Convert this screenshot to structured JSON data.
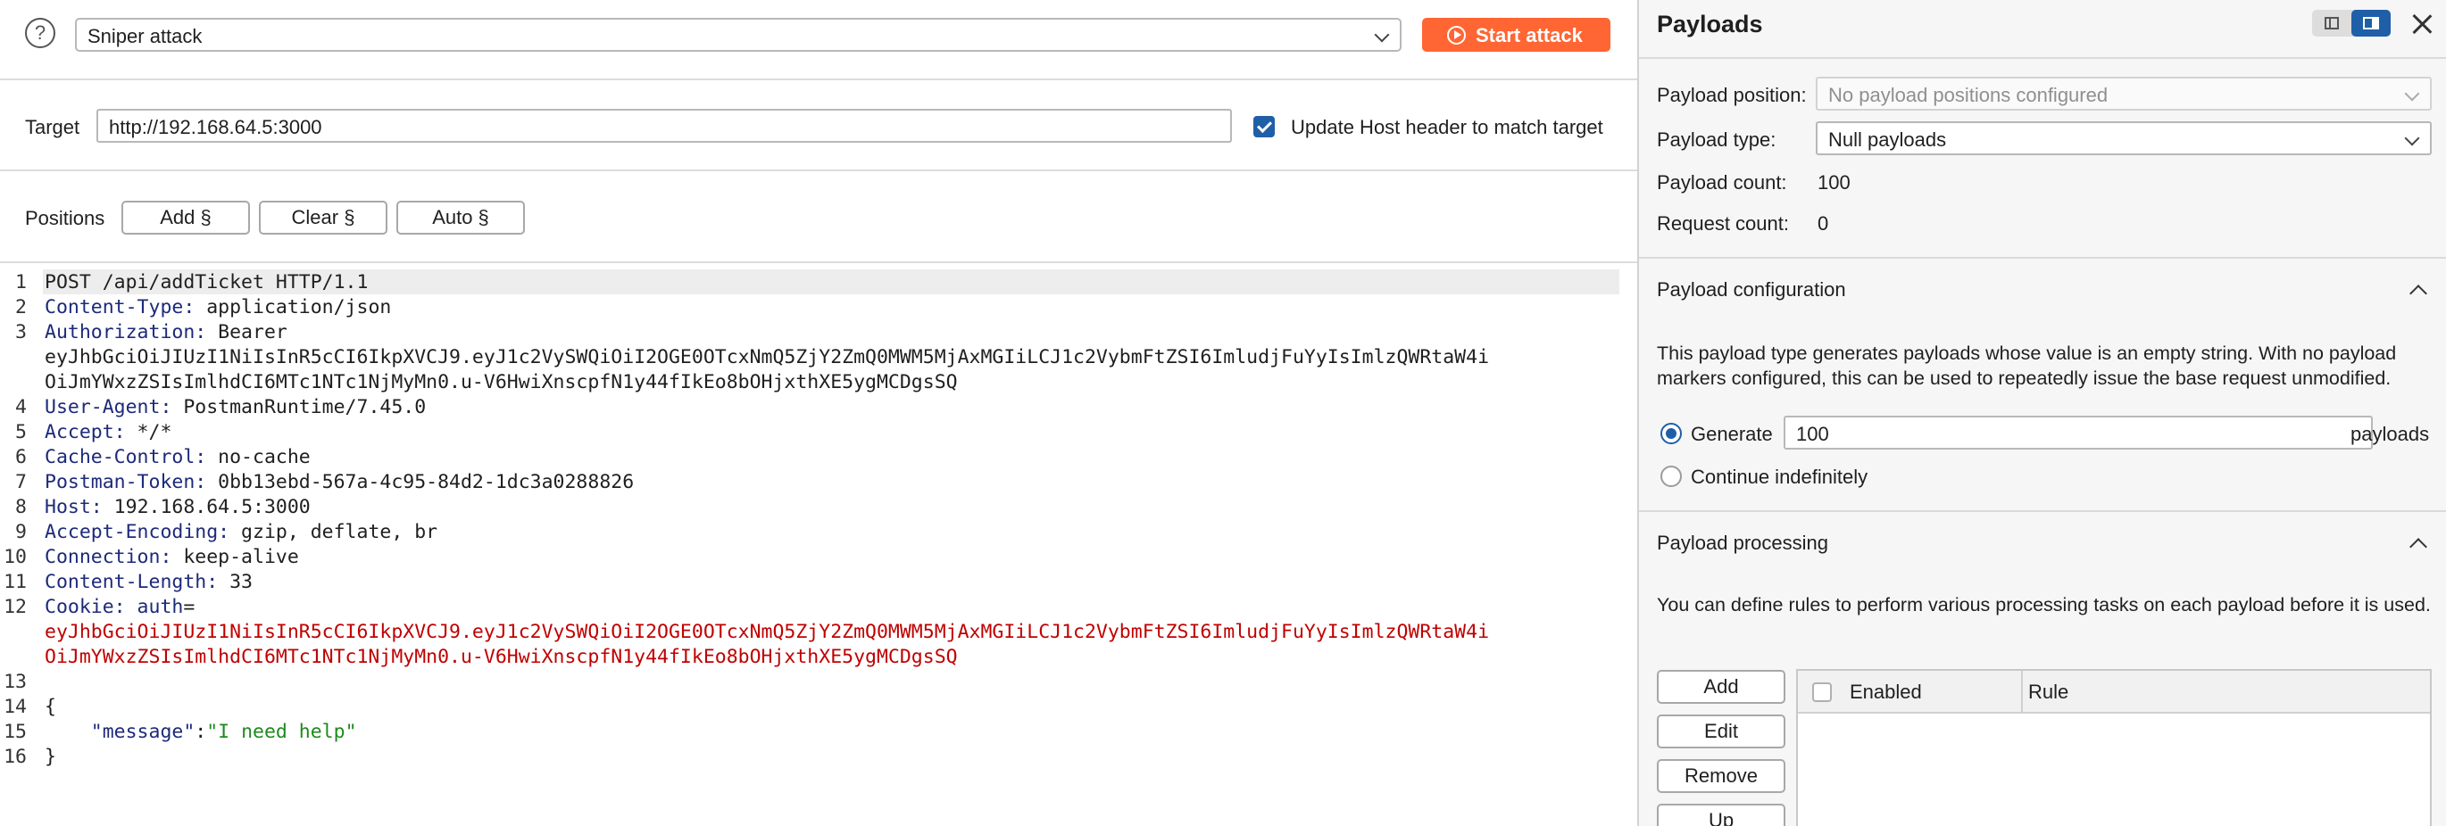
{
  "attack_bar": {
    "attack_type": "Sniper attack",
    "start_attack_label": "Start attack"
  },
  "target": {
    "label": "Target",
    "value": "http://192.168.64.5:3000",
    "update_host_label": "Update Host header to match target",
    "update_host_checked": true
  },
  "positions": {
    "label": "Positions",
    "add_label": "Add §",
    "clear_label": "Clear §",
    "auto_label": "Auto §"
  },
  "request": {
    "line_numbers": [
      "1",
      "2",
      "3",
      "4",
      "5",
      "6",
      "7",
      "8",
      "9",
      "10",
      "11",
      "12",
      "13",
      "14",
      "15",
      "16"
    ],
    "l1": "POST /api/addTicket HTTP/1.1",
    "l2_name": "Content-Type:",
    "l2_val": " application/json",
    "l3_name": "Authorization:",
    "l3_val": " Bearer",
    "l3_wrap1": "eyJhbGciOiJIUzI1NiIsInR5cCI6IkpXVCJ9.eyJ1c2VySWQiOiI2OGE0OTcxNmQ5ZjY2ZmQ0MWM5MjAxMGIiLCJ1c2VybmFtZSI6ImludjFuYyIsImlzQWRtaW4i",
    "l3_wrap2": "OiJmYWxzZSIsImlhdCI6MTc1NTc1NjMyMn0.u-V6HwiXnscpfN1y44fIkEo8bOHjxthXE5ygMCDgsSQ",
    "l4_name": "User-Agent:",
    "l4_val": " PostmanRuntime/7.45.0",
    "l5_name": "Accept:",
    "l5_val": " */*",
    "l6_name": "Cache-Control:",
    "l6_val": " no-cache",
    "l7_name": "Postman-Token:",
    "l7_val": " 0bb13ebd-567a-4c95-84d2-1dc3a0288826",
    "l8_name": "Host:",
    "l8_val": " 192.168.64.5:3000",
    "l9_name": "Accept-Encoding:",
    "l9_val": " gzip, deflate, br",
    "l10_name": "Connection:",
    "l10_val": " keep-alive",
    "l11_name": "Content-Length:",
    "l11_val": " 33",
    "l12_name": "Cookie:",
    "l12_key": " auth",
    "l12_eq": "=",
    "l12_wrap1": "eyJhbGciOiJIUzI1NiIsInR5cCI6IkpXVCJ9.eyJ1c2VySWQiOiI2OGE0OTcxNmQ5ZjY2ZmQ0MWM5MjAxMGIiLCJ1c2VybmFtZSI6ImludjFuYyIsImlzQWRtaW4i",
    "l12_wrap2": "OiJmYWxzZSIsImlhdCI6MTc1NTc1NjMyMn0.u-V6HwiXnscpfN1y44fIkEo8bOHjxthXE5ygMCDgsSQ",
    "l14": "{",
    "l15_key": "\"message\"",
    "l15_colon": ":",
    "l15_val": "\"I need help\"",
    "l16": "}"
  },
  "payloads_panel": {
    "title": "Payloads",
    "position_label": "Payload position:",
    "position_value": "No payload positions configured",
    "type_label": "Payload type:",
    "type_value": "Null payloads",
    "count_label": "Payload count:",
    "count_value": "100",
    "request_count_label": "Request count:",
    "request_count_value": "0",
    "config_title": "Payload configuration",
    "config_text": "This payload type generates payloads whose value is an empty string. With no payload markers configured, this can be used to repeatedly issue the base request unmodified.",
    "generate_label": "Generate",
    "generate_value": "100",
    "generate_suffix": "payloads",
    "continue_label": "Continue indefinitely",
    "processing_title": "Payload processing",
    "processing_text": "You can define rules to perform various processing tasks on each payload before it is used.",
    "buttons": {
      "add": "Add",
      "edit": "Edit",
      "remove": "Remove",
      "up": "Up"
    },
    "table_headers": {
      "enabled": "Enabled",
      "rule": "Rule"
    }
  },
  "colors": {
    "accent": "#ff6633",
    "primary_blue": "#1f5fa8",
    "header_name": "#1d2a7a",
    "cookie_value": "#c00000",
    "json_string": "#1d8a1d"
  },
  "icons": [
    "help-icon",
    "chevron-down-icon",
    "play-circle-icon",
    "checkbox-icon",
    "layout-horizontal-icon",
    "layout-split-icon",
    "close-icon",
    "chevron-up-icon"
  ]
}
